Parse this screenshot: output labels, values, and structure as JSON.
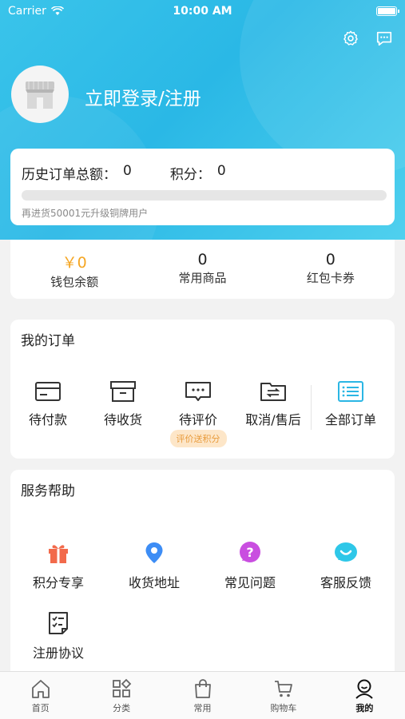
{
  "status_bar": {
    "carrier": "Carrier",
    "time": "10:00 AM"
  },
  "header": {
    "login_text": "立即登录/注册",
    "icons": [
      "gear-icon",
      "chat-icon"
    ]
  },
  "stats": {
    "order_total_label": "历史订单总额：",
    "order_total_value": "0",
    "points_label": "积分：",
    "points_value": "0",
    "progress_fraction": 0.0,
    "hint": "再进货50001元升级铜牌用户"
  },
  "wallet": [
    {
      "value": "￥0",
      "label": "钱包余额"
    },
    {
      "value": "0",
      "label": "常用商品"
    },
    {
      "value": "0",
      "label": "红包卡券"
    }
  ],
  "orders": {
    "title": "我的订单",
    "items": [
      {
        "label": "待付款",
        "icon": "card-icon"
      },
      {
        "label": "待收货",
        "icon": "box-icon"
      },
      {
        "label": "待评价",
        "icon": "comment-icon",
        "badge": "评价送积分"
      },
      {
        "label": "取消/售后",
        "icon": "exchange-icon"
      }
    ],
    "all": {
      "label": "全部订单",
      "icon": "list-icon"
    }
  },
  "help": {
    "title": "服务帮助",
    "items": [
      {
        "label": "积分专享",
        "icon": "gift-icon",
        "color": "#f26a4b"
      },
      {
        "label": "收货地址",
        "icon": "location-icon",
        "color": "#3d8df5"
      },
      {
        "label": "常见问题",
        "icon": "question-icon",
        "color": "#c94ee0"
      },
      {
        "label": "客服反馈",
        "icon": "smile-icon",
        "color": "#2ec7e8"
      },
      {
        "label": "注册协议",
        "icon": "checklist-icon",
        "color": "#333333"
      }
    ]
  },
  "tabbar": [
    {
      "label": "首页",
      "icon": "home-icon"
    },
    {
      "label": "分类",
      "icon": "category-icon"
    },
    {
      "label": "常用",
      "icon": "bag-icon"
    },
    {
      "label": "购物车",
      "icon": "cart-icon"
    },
    {
      "label": "我的",
      "icon": "user-icon",
      "active": true
    }
  ],
  "colors": {
    "accent": "#1fb7e6",
    "wallet_value": "#f5a623",
    "badge_bg": "#fde6c8",
    "badge_text": "#e89b3c"
  }
}
